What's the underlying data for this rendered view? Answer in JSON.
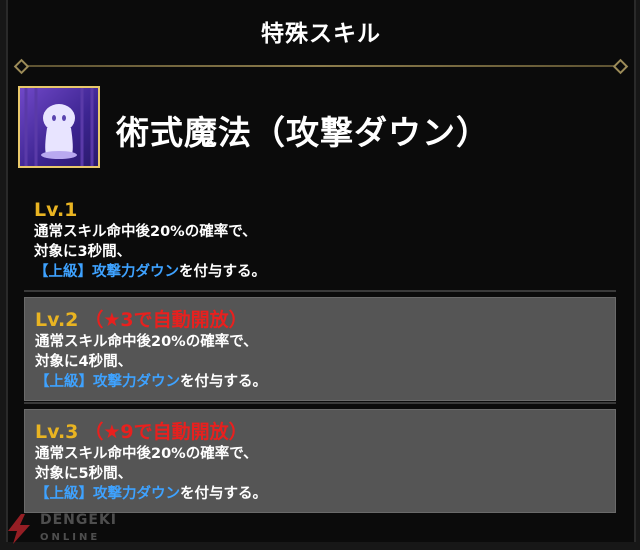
{
  "header": {
    "title": "特殊スキル"
  },
  "skill": {
    "name": "術式魔法（攻撃ダウン）",
    "icon": "ghost-character-icon"
  },
  "levels": [
    {
      "label": "Lv.1",
      "note": "",
      "line1": "通常スキル命中後20%の確率で、",
      "line2": "対象に3秒間、",
      "tag": "【上級】攻撃力ダウン",
      "suffix": "を付与する。"
    },
    {
      "label": "Lv.2",
      "note": "（★3で自動開放）",
      "line1": "通常スキル命中後20%の確率で、",
      "line2": "対象に4秒間、",
      "tag": "【上級】攻撃力ダウン",
      "suffix": "を付与する。"
    },
    {
      "label": "Lv.3",
      "note": "（★9で自動開放）",
      "line1": "通常スキル命中後20%の確率で、",
      "line2": "対象に5秒間、",
      "tag": "【上級】攻撃力ダウン",
      "suffix": "を付与する。"
    }
  ],
  "watermark": {
    "text": "DENGEKI",
    "sub": "ONLINE"
  },
  "colors": {
    "level_label": "#e9b422",
    "unlock_note": "#e8201e",
    "status_tag": "#3ea2ff",
    "locked_bg": "#555555"
  }
}
